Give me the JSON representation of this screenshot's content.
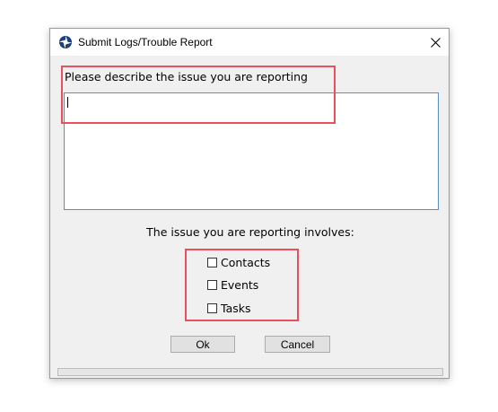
{
  "dialog": {
    "title": "Submit Logs/Trouble Report",
    "icons": {
      "app": "aperture-icon",
      "close": "close-icon"
    },
    "close_glyph": "✕"
  },
  "description": {
    "label": "Please describe the issue you are reporting",
    "value": "",
    "placeholder": ""
  },
  "involves": {
    "label": "The issue you are reporting involves:",
    "options": [
      {
        "label": "Contacts",
        "checked": false
      },
      {
        "label": "Events",
        "checked": false
      },
      {
        "label": "Tasks",
        "checked": false
      }
    ]
  },
  "buttons": {
    "ok": "Ok",
    "cancel": "Cancel"
  },
  "progress": {
    "value": 0
  },
  "colors": {
    "highlight": "#e8505b",
    "textarea_border": "#5a8fc4",
    "dialog_bg": "#f0f0f0"
  }
}
